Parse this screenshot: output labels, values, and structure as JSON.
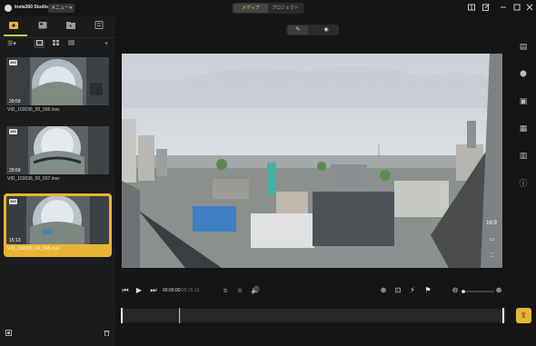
{
  "app": {
    "name": "Insta360 Studio",
    "menu_label": "メニュー"
  },
  "mode_tabs": [
    {
      "label": "メディア"
    },
    {
      "label": "プロジェクト"
    }
  ],
  "media": [
    {
      "badge": "360",
      "duration": "29:59",
      "filename": "VID_103036_00_006.insv"
    },
    {
      "badge": "360",
      "duration": "29:59",
      "filename": "VID_103036_00_007.insv"
    },
    {
      "badge": "360",
      "duration": "15:13",
      "filename": "VID_103036_00_008.insv"
    }
  ],
  "player": {
    "time_current": "00:00:00",
    "time_total": "/00:15:13",
    "ratio_label": "16:9"
  },
  "colors": {
    "accent": "#e8b533",
    "bg": "#1e1e1e",
    "panel": "#1b1b1b"
  },
  "icons": {
    "window": [
      "layout-icon",
      "edit-icon",
      "minimize-icon",
      "maximize-icon",
      "close-icon"
    ],
    "right_toolbar": [
      "reframe-icon",
      "plugin-icon",
      "snapshot-icon",
      "export-settings-icon",
      "stitch-icon",
      "info-icon"
    ]
  }
}
